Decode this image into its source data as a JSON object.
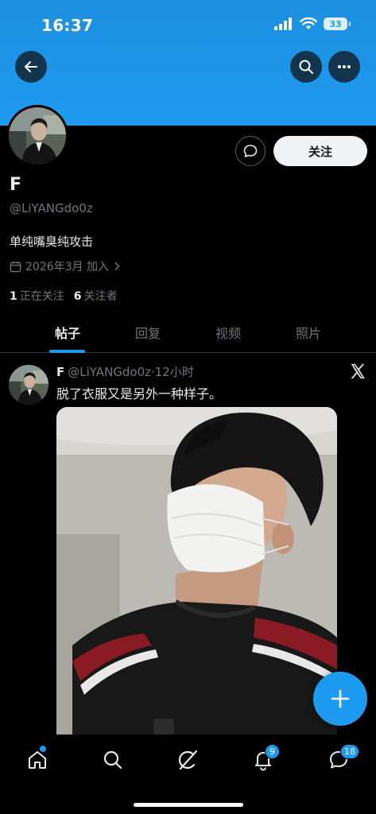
{
  "status_bar": {
    "time": "16:37",
    "battery": "33",
    "icons": [
      "signal-icon",
      "wifi-icon",
      "battery-icon"
    ]
  },
  "header": {
    "back_icon": "arrow-left-icon",
    "search_icon": "search-icon",
    "more_icon": "more-horizontal-icon"
  },
  "profile": {
    "display_name": "F",
    "handle": "@LiYANGdo0z",
    "bio": "单纯嘴臭纯攻击",
    "joined": "2026年3月 加入",
    "following_count": "1",
    "following_label": "正在关注",
    "followers_count": "6",
    "followers_label": "关注者",
    "follow_button": "关注",
    "message_icon": "message-bubble-icon"
  },
  "tabs": [
    {
      "label": "帖子",
      "active": true
    },
    {
      "label": "回复",
      "active": false
    },
    {
      "label": "视频",
      "active": false
    },
    {
      "label": "照片",
      "active": false
    }
  ],
  "post": {
    "author_name": "F",
    "author_handle": "@LiYANGdo0z",
    "time": "·12小时",
    "text": "脱了衣服又是另外一种样子。",
    "source_icon": "x-logo-icon"
  },
  "fab": {
    "icon": "plus-icon"
  },
  "bottom_nav": {
    "items": [
      {
        "icon": "home-icon",
        "badge": ""
      },
      {
        "icon": "search-icon",
        "badge": ""
      },
      {
        "icon": "grok-icon",
        "badge": ""
      },
      {
        "icon": "bell-icon",
        "badge": "9"
      },
      {
        "icon": "chat-icon",
        "badge": "18"
      }
    ]
  },
  "colors": {
    "accent": "#1d9bf0",
    "background": "#000000",
    "banner": "#1e9bf0",
    "secondary_text": "#71767b"
  }
}
